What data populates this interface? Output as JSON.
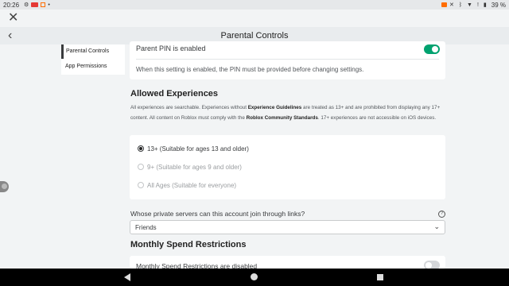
{
  "status": {
    "time": "20:26",
    "battery": "39 %"
  },
  "header": {
    "title": "Parental Controls"
  },
  "sidebar": {
    "items": [
      {
        "label": "Parental Controls"
      },
      {
        "label": "App Permissions"
      }
    ]
  },
  "pin": {
    "label": "Parent PIN is enabled",
    "enabled": true,
    "description": "When this setting is enabled, the PIN must be provided before changing settings."
  },
  "allowed": {
    "title": "Allowed Experiences",
    "text1": "All experiences are searchable. Experiences without ",
    "bold1": "Experience Guidelines",
    "text2": " are treated as 13+ and are prohibited from displaying any 17+ content. All content on Roblox must comply with the ",
    "bold2": "Roblox Community Standards",
    "text3": ". 17+ experiences are not accessible on iOS devices.",
    "options": [
      {
        "label": "13+ (Suitable for ages 13 and older)",
        "selected": true
      },
      {
        "label": "9+ (Suitable for ages 9 and older)",
        "selected": false
      },
      {
        "label": "All Ages (Suitable for everyone)",
        "selected": false
      }
    ]
  },
  "private_servers": {
    "question": "Whose private servers can this account join through links?",
    "help_icon": "?",
    "value": "Friends"
  },
  "spend": {
    "title": "Monthly Spend Restrictions",
    "label": "Monthly Spend Restrictions are disabled",
    "enabled": false
  },
  "colors": {
    "toggle_on": "#00a26f",
    "toggle_off": "#d4d6d9"
  }
}
